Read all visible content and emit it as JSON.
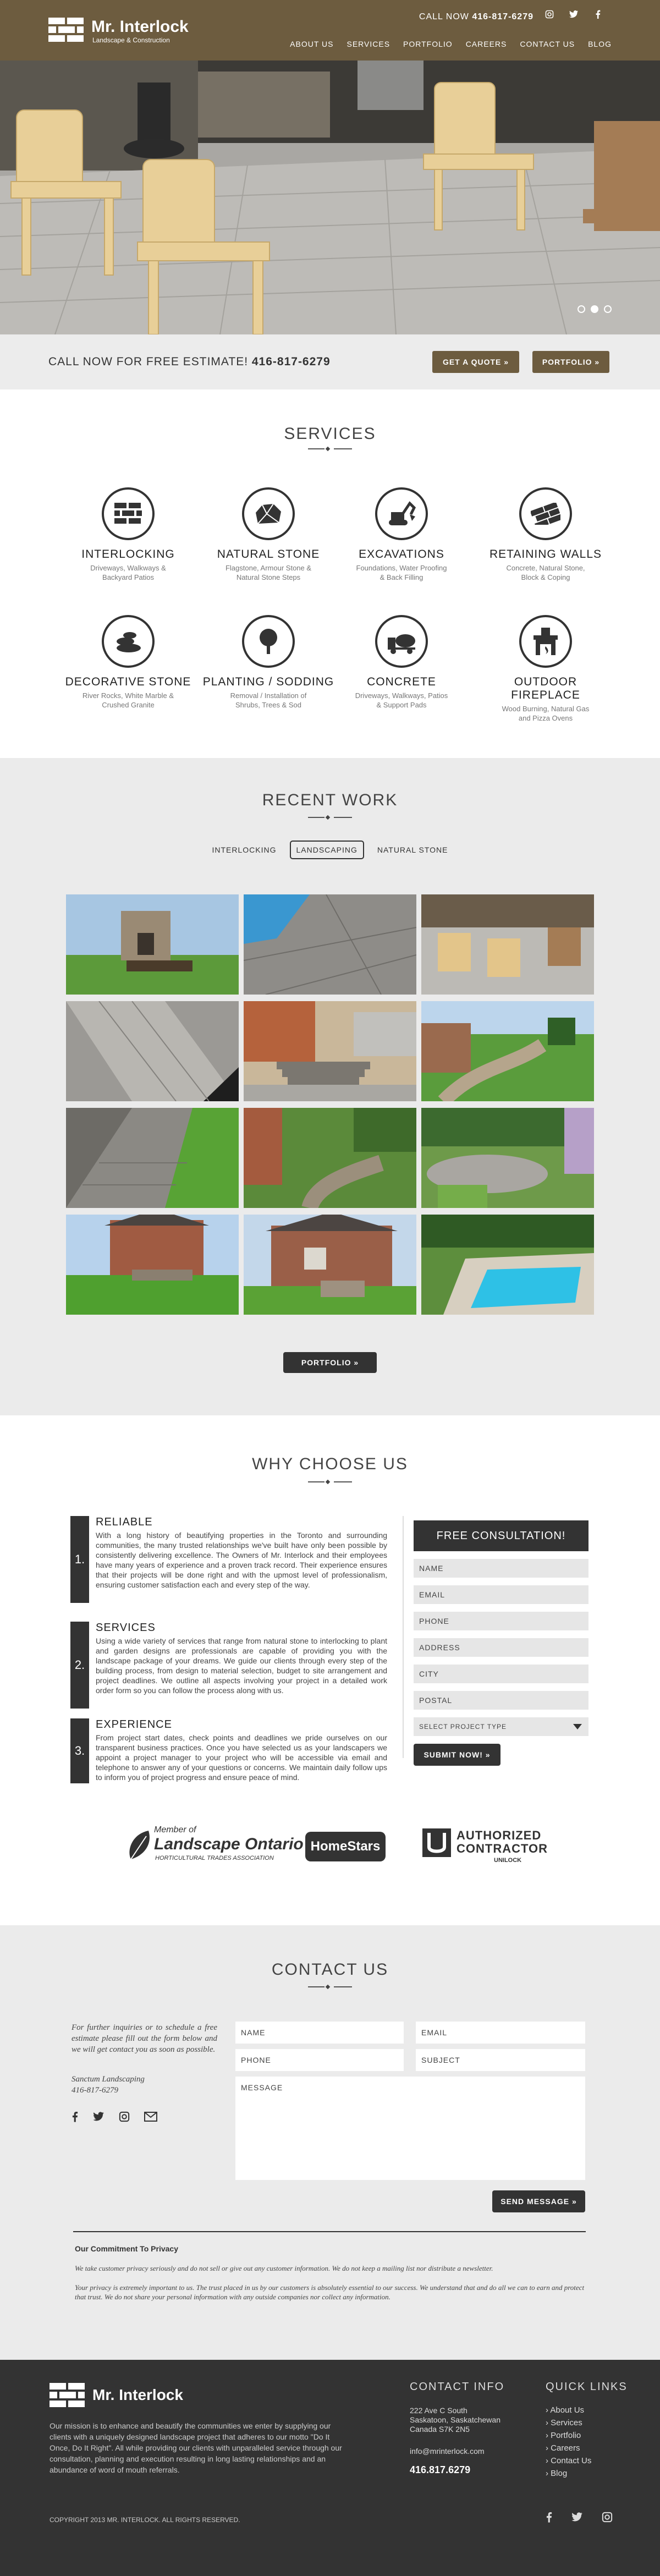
{
  "header": {
    "logo_name": "Mr. Interlock",
    "logo_tagline": "Landscape & Construction",
    "call_label": "CALL NOW",
    "phone": "416-817-6279",
    "social": [
      "instagram-icon",
      "twitter-icon",
      "facebook-icon"
    ],
    "nav": [
      "ABOUT US",
      "SERVICES",
      "PORTFOLIO",
      "CAREERS",
      "CONTACT US",
      "BLOG"
    ]
  },
  "hero": {
    "slides_total": 3,
    "active_slide": 2
  },
  "estimate": {
    "text": "CALL NOW FOR FREE ESTIMATE!",
    "phone": "416-817-6279",
    "quote_button": "GET A QUOTE »",
    "portfolio_button": "PORTFOLIO »"
  },
  "services": {
    "title": "SERVICES",
    "items": [
      {
        "title": "INTERLOCKING",
        "desc": "Driveways, Walkways & Backyard Patios",
        "icon": "brick-icon"
      },
      {
        "title": "NATURAL STONE",
        "desc": "Flagstone, Armour Stone & Natural Stone Steps",
        "icon": "stone-icon"
      },
      {
        "title": "EXCAVATIONS",
        "desc": "Foundations, Water Proofing & Back Filling",
        "icon": "excavator-icon"
      },
      {
        "title": "RETAINING WALLS",
        "desc": "Concrete, Natural Stone, Block & Coping",
        "icon": "wall-icon"
      },
      {
        "title": "DECORATIVE STONE",
        "desc": "River Rocks, White Marble & Crushed Granite",
        "icon": "rocks-icon"
      },
      {
        "title": "PLANTING / SODDING",
        "desc": "Removal / Installation of Shrubs, Trees & Sod",
        "icon": "tree-icon"
      },
      {
        "title": "CONCRETE",
        "desc": "Driveways, Walkways, Patios & Support Pads",
        "icon": "cement-mixer-icon"
      },
      {
        "title": "OUTDOOR FIREPLACE",
        "desc": "Wood Burning, Natural Gas and Pizza Ovens",
        "icon": "fireplace-icon"
      }
    ]
  },
  "recent_work": {
    "title": "RECENT WORK",
    "filters": [
      "INTERLOCKING",
      "LANDSCAPING",
      "NATURAL STONE"
    ],
    "active_filter": "LANDSCAPING",
    "portfolio_button": "PORTFOLIO »"
  },
  "why": {
    "title": "WHY CHOOSE US",
    "items": [
      {
        "num": "1.",
        "head": "RELIABLE",
        "text": "With a long history of beautifying properties in the Toronto and surrounding communities, the many trusted relationships we've built have only been possible by consistently delivering excellence. The Owners of Mr. Interlock and their employees have many years of experience and a proven track record. Their experience ensures that their projects will be done right and with the upmost level of professionalism, ensuring customer satisfaction each and every step of the way."
      },
      {
        "num": "2.",
        "head": "SERVICES",
        "text": "Using a wide variety of services that range from natural stone to interlocking to plant and garden designs are professionals are capable of providing you with the landscape package of your dreams. We guide our clients through every step of the building process, from design to material selection, budget to site arrangement and project deadlines. We outline all aspects involving your project in a detailed work order form so you can follow the process along with us."
      },
      {
        "num": "3.",
        "head": "EXPERIENCE",
        "text": "From project start dates, check points and deadlines we pride ourselves on our transparent business practices. Once you have selected us as your landscapers we appoint a project manager to your project who will be accessible via email and telephone to answer any of your questions or concerns. We maintain daily follow ups to inform you of project progress and ensure peace of mind."
      }
    ]
  },
  "consultation": {
    "title": "FREE CONSULTATION!",
    "fields": [
      "NAME",
      "EMAIL",
      "PHONE",
      "ADDRESS",
      "CITY",
      "POSTAL"
    ],
    "select_placeholder": "SELECT PROJECT TYPE",
    "submit": "SUBMIT NOW! »"
  },
  "partners": {
    "lo_member": "Member of",
    "lo_name": "Landscape Ontario",
    "lo_sub": "HORTICULTURAL TRADES ASSOCIATION",
    "homestars": "HomeStars",
    "authorized": "AUTHORIZED",
    "contractor": "CONTRACTOR",
    "unilock": "UNILOCK"
  },
  "contact": {
    "title": "CONTACT US",
    "intro": "For further inquiries or to schedule a free estimate please fill out the form below and we will get contact you as soon as possible.",
    "company": "Sanctum Landscaping",
    "phone": "416-817-6279",
    "social": [
      "facebook-icon",
      "twitter-icon",
      "instagram-icon",
      "email-icon"
    ],
    "name_ph": "NAME",
    "email_ph": "EMAIL",
    "phone_ph": "PHONE",
    "subject_ph": "SUBJECT",
    "message_ph": "MESSAGE",
    "send": "SEND MESSAGE »",
    "privacy_head": "Our Commitment To Privacy",
    "privacy_1": "We take customer privacy seriously and do not sell or give out any customer information. We do not keep a mailing list nor distribute a newsletter.",
    "privacy_2": "Your privacy is extremely important to us. The trust placed in us by our customers is absolutely essential to our success. We understand that and do all we can to earn and protect that trust. We do not share your personal information with any outside companies nor collect any information."
  },
  "footer": {
    "logo_name": "Mr. Interlock",
    "mission": "Our mission is to enhance and beautify the communities we enter by supplying our clients with a uniquely designed landscape project that adheres to our motto \"Do It Once, Do It Right\". All while providing our clients with unparalleled service through our consultation, planning and execution resulting in long lasting relationships and an abundance of word of mouth referrals.",
    "contact_head": "CONTACT INFO",
    "address": [
      "222 Ave C South",
      "Saskatoon, Saskatchewan",
      "Canada S7K 2N5"
    ],
    "email": "info@mrinterlock.com",
    "phone": "416.817.6279",
    "links_head": "QUICK LINKS",
    "links": [
      "About Us",
      "Services",
      "Portfolio",
      "Careers",
      "Contact Us",
      "Blog"
    ],
    "copyright": "COPYRIGHT 2013 MR. INTERLOCK. ALL RIGHTS RESERVED.",
    "social": [
      "facebook-icon",
      "twitter-icon",
      "instagram-icon"
    ]
  },
  "colors": {
    "brand_brown": "#6d5c3f",
    "dark": "#333333",
    "light_bg": "#ebebeb"
  }
}
